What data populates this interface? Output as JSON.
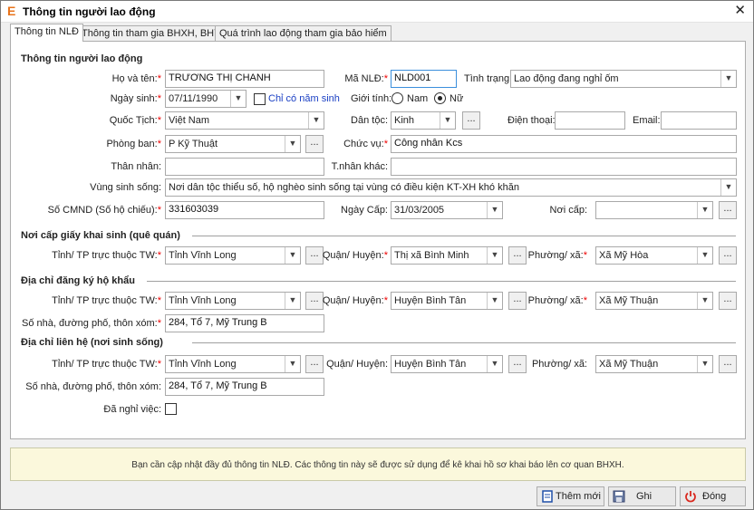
{
  "window": {
    "title": "Thông tin người lao động",
    "app_icon": "E",
    "close": "✕"
  },
  "tabs": [
    {
      "label": "Thông tin NLĐ"
    },
    {
      "label": "Thông tin tham gia BHXH, BHYT"
    },
    {
      "label": "Quá trình lao động tham gia bảo hiểm"
    }
  ],
  "personal": {
    "section_title": "Thông tin người lao động",
    "ho_ten_label": "Họ và tên:",
    "ho_ten": "TRƯƠNG THỊ CHANH",
    "ma_nld_label": "Mã NLĐ:",
    "ma_nld": "NLD001",
    "tinh_trang_label": "Tình trạng:",
    "tinh_trang": "Lao động đang nghỉ ốm",
    "ngay_sinh_label": "Ngày sinh:",
    "ngay_sinh": "07/11/1990",
    "chi_nam_sinh_label": "Chỉ có năm sinh",
    "gioi_tinh_label": "Giới tính:",
    "nam_label": "Nam",
    "nu_label": "Nữ",
    "quoc_tich_label": "Quốc Tịch:",
    "quoc_tich": "Việt Nam",
    "dan_toc_label": "Dân tộc:",
    "dan_toc": "Kinh",
    "dien_thoai_label": "Điện thoại:",
    "dien_thoai": "",
    "email_label": "Email:",
    "email": "",
    "phong_ban_label": "Phòng ban:",
    "phong_ban": "P Kỹ Thuật",
    "chuc_vu_label": "Chức vụ:",
    "chuc_vu": "Công nhân Kcs",
    "than_nhan_label": "Thân nhân:",
    "than_nhan": "",
    "t_nhan_khac_label": "T.nhân khác:",
    "t_nhan_khac": "",
    "vung_sinh_song_label": "Vùng sinh sống:",
    "vung_sinh_song": "Nơi dân tộc thiểu số, hộ nghèo sinh sống tại vùng có điều kiện KT-XH khó khăn",
    "so_cmnd_label": "Số CMND (Số hộ chiếu):",
    "so_cmnd": "331603039",
    "ngay_cap_label": "Ngày Cấp:",
    "ngay_cap": "31/03/2005",
    "noi_cap_label": "Nơi cấp:",
    "noi_cap": ""
  },
  "birth_place": {
    "section_title": "Nơi cấp giấy khai sinh (quê quán)",
    "tinh_label": "Tỉnh/ TP trực thuộc TW:",
    "tinh": "Tỉnh Vĩnh Long",
    "huyen_label": "Quận/ Huyện:",
    "huyen": "Thị xã Bình Minh",
    "xa_label": "Phường/ xã:",
    "xa": "Xã Mỹ Hòa"
  },
  "household": {
    "section_title": "Địa chỉ đăng ký hộ khẩu",
    "tinh_label": "Tỉnh/ TP trực thuộc TW:",
    "tinh": "Tỉnh Vĩnh Long",
    "huyen_label": "Quận/ Huyện:",
    "huyen": "Huyện Bình Tân",
    "xa_label": "Phường/ xã:",
    "xa": "Xã Mỹ Thuận",
    "so_nha_label": "Số nhà, đường phố, thôn xóm:",
    "so_nha": "284, Tổ 7, Mỹ Trung B"
  },
  "contact": {
    "section_title": "Địa chỉ liên hệ (nơi sinh sống)",
    "tinh_label": "Tỉnh/ TP trực thuộc TW:",
    "tinh": "Tỉnh Vĩnh Long",
    "huyen_label": "Quận/ Huyện:",
    "huyen": "Huyện Bình Tân",
    "xa_label": "Phường/ xã:",
    "xa": "Xã Mỹ Thuận",
    "so_nha_label": "Số nhà, đường phố, thôn xóm:",
    "so_nha": "284, Tổ 7, Mỹ Trung B",
    "da_nghi_viec_label": "Đã nghỉ việc:"
  },
  "common": {
    "required_mark": "*",
    "dots": "...",
    "arrow": "▼"
  },
  "notice": "Bạn cần cập nhật đầy đủ thông tin NLĐ. Các thông tin này sẽ được sử dụng để kê khai hồ sơ khai báo lên cơ quan BHXH.",
  "buttons": {
    "them_moi": "Thêm mới",
    "ghi": "Ghi",
    "dong": "Đóng"
  },
  "colors": {
    "required": "#e00000",
    "link": "#1a3fc4",
    "close_icon_red": "#d9291f",
    "notice_bg": "#fbf8dc"
  }
}
